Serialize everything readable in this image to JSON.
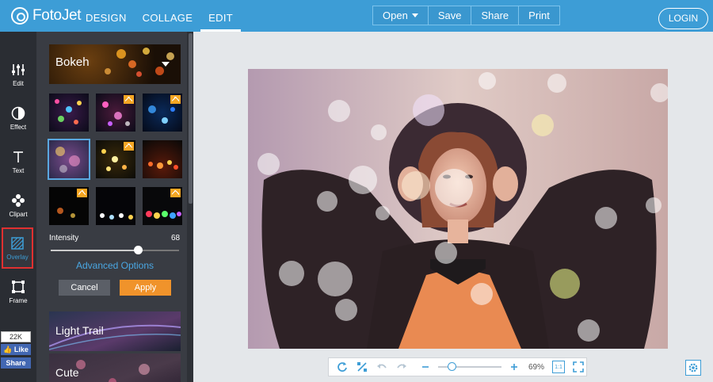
{
  "app": {
    "logo": "FotoJet"
  },
  "nav": {
    "tabs": [
      "DESIGN",
      "COLLAGE",
      "EDIT"
    ],
    "active": "EDIT"
  },
  "toolbar": {
    "open": "Open",
    "save": "Save",
    "share": "Share",
    "print": "Print"
  },
  "account": {
    "login": "LOGIN"
  },
  "tools": [
    {
      "label": "Edit",
      "icon": "sliders-icon"
    },
    {
      "label": "Effect",
      "icon": "half-circle-icon"
    },
    {
      "label": "Text",
      "icon": "text-icon"
    },
    {
      "label": "Clipart",
      "icon": "flower-icon"
    },
    {
      "label": "Overlay",
      "icon": "overlay-icon",
      "active": true
    },
    {
      "label": "Frame",
      "icon": "frame-icon"
    }
  ],
  "social": {
    "count": "22K",
    "like": "Like",
    "share": "Share"
  },
  "panel": {
    "category": "Bokeh",
    "intensity_label": "Intensity",
    "intensity_value": "68",
    "intensity_fraction": 0.68,
    "advanced": "Advanced Options",
    "cancel": "Cancel",
    "apply": "Apply",
    "other_categories": [
      "Light Trail",
      "Cute"
    ]
  },
  "zoom": {
    "value": "69%",
    "actual_size": "1:1"
  },
  "colors": {
    "brand": "#3d9dd6",
    "apply": "#f0932b",
    "panel": "#393c43",
    "strip": "#2a2d33"
  }
}
